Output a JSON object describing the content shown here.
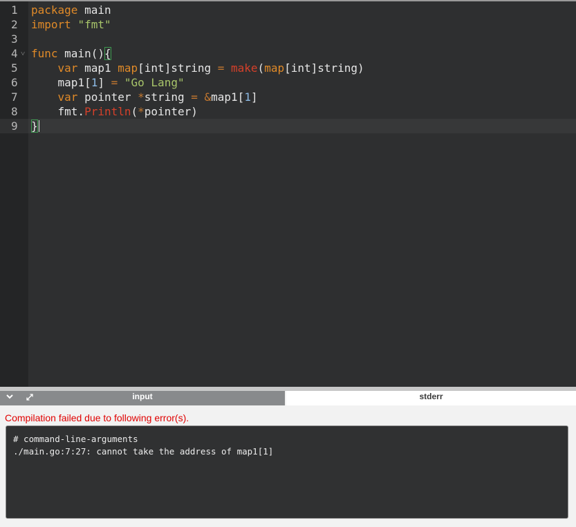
{
  "editor": {
    "lines": [
      {
        "n": "1",
        "tokens": [
          [
            "kw",
            "package"
          ],
          [
            "p",
            " main"
          ]
        ]
      },
      {
        "n": "2",
        "tokens": [
          [
            "kw",
            "import"
          ],
          [
            "p",
            " "
          ],
          [
            "str",
            "\"fmt\""
          ]
        ]
      },
      {
        "n": "3",
        "tokens": []
      },
      {
        "n": "4",
        "fold": true,
        "tokens": [
          [
            "kw",
            "func"
          ],
          [
            "p",
            " main()"
          ],
          [
            "brk",
            "{"
          ]
        ]
      },
      {
        "n": "5",
        "tokens": [
          [
            "p",
            "    "
          ],
          [
            "kw",
            "var"
          ],
          [
            "p",
            " map1 "
          ],
          [
            "kw",
            "map"
          ],
          [
            "p",
            "[int]string "
          ],
          [
            "op",
            "="
          ],
          [
            "p",
            " "
          ],
          [
            "fn",
            "make"
          ],
          [
            "p",
            "("
          ],
          [
            "kw",
            "map"
          ],
          [
            "p",
            "[int]string)"
          ]
        ]
      },
      {
        "n": "6",
        "tokens": [
          [
            "p",
            "    map1["
          ],
          [
            "num",
            "1"
          ],
          [
            "p",
            "] "
          ],
          [
            "op",
            "="
          ],
          [
            "p",
            " "
          ],
          [
            "str",
            "\"Go Lang\""
          ]
        ]
      },
      {
        "n": "7",
        "tokens": [
          [
            "p",
            "    "
          ],
          [
            "kw",
            "var"
          ],
          [
            "p",
            " pointer "
          ],
          [
            "op",
            "*"
          ],
          [
            "p",
            "string "
          ],
          [
            "op",
            "="
          ],
          [
            "p",
            " "
          ],
          [
            "op",
            "&"
          ],
          [
            "p",
            "map1["
          ],
          [
            "num",
            "1"
          ],
          [
            "p",
            "]"
          ]
        ]
      },
      {
        "n": "8",
        "tokens": [
          [
            "p",
            "    fmt."
          ],
          [
            "fn",
            "Println"
          ],
          [
            "p",
            "("
          ],
          [
            "op",
            "*"
          ],
          [
            "p",
            "pointer)"
          ]
        ]
      },
      {
        "n": "9",
        "active": true,
        "tokens": [
          [
            "brk",
            "}"
          ],
          [
            "cursor",
            ""
          ]
        ]
      }
    ]
  },
  "io": {
    "collapse_icon": "chevron-down-icon",
    "expand_icon": "expand-arrows-icon",
    "input_tab": "input",
    "stderr_tab": "stderr"
  },
  "output": {
    "error_message": "Compilation failed due to following error(s).",
    "console_lines": [
      "# command-line-arguments",
      "./main.go:7:27: cannot take the address of map1[1]"
    ]
  }
}
